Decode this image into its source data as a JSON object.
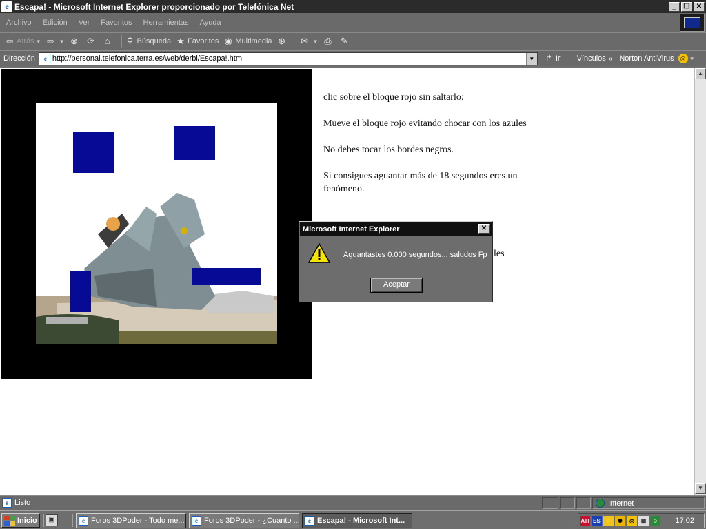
{
  "window": {
    "title": "Escapa! - Microsoft Internet Explorer proporcionado por Telefónica Net"
  },
  "menu": [
    "Archivo",
    "Edición",
    "Ver",
    "Favoritos",
    "Herramientas",
    "Ayuda"
  ],
  "toolbar": {
    "back": "Atrás",
    "search": "Búsqueda",
    "favorites": "Favoritos",
    "media": "Multimedia"
  },
  "address": {
    "label": "Dirección",
    "url": "http://personal.telefonica.terra.es/web/derbi/Escapa!.htm",
    "go": "Ir",
    "links": "Vínculos",
    "norton": "Norton AntiVirus"
  },
  "page": {
    "paragraphs": [
      "clic sobre el bloque rojo sin saltarlo:",
      "Mueve el bloque rojo evitando chocar con los azules",
      "No debes tocar los bordes negros.",
      "Si consigues aguantar más de 18 segundos eres un fenómeno."
    ],
    "partial": "les"
  },
  "dialog": {
    "title": "Microsoft Internet Explorer",
    "message": "Aguantastes 0.000 segundos... saludos Fp",
    "ok": "Aceptar"
  },
  "status": {
    "text": "Listo",
    "zone": "Internet"
  },
  "taskbar": {
    "start": "Inicio",
    "tasks": [
      "Foros 3DPoder - Todo me...",
      "Foros 3DPoder - ¿Cuanto ...",
      "Escapa! - Microsoft Int..."
    ],
    "tray": [
      "ATI",
      "ES"
    ],
    "clock": "17:02"
  },
  "colors": {
    "block": "#060a94",
    "frame": "#000000"
  }
}
